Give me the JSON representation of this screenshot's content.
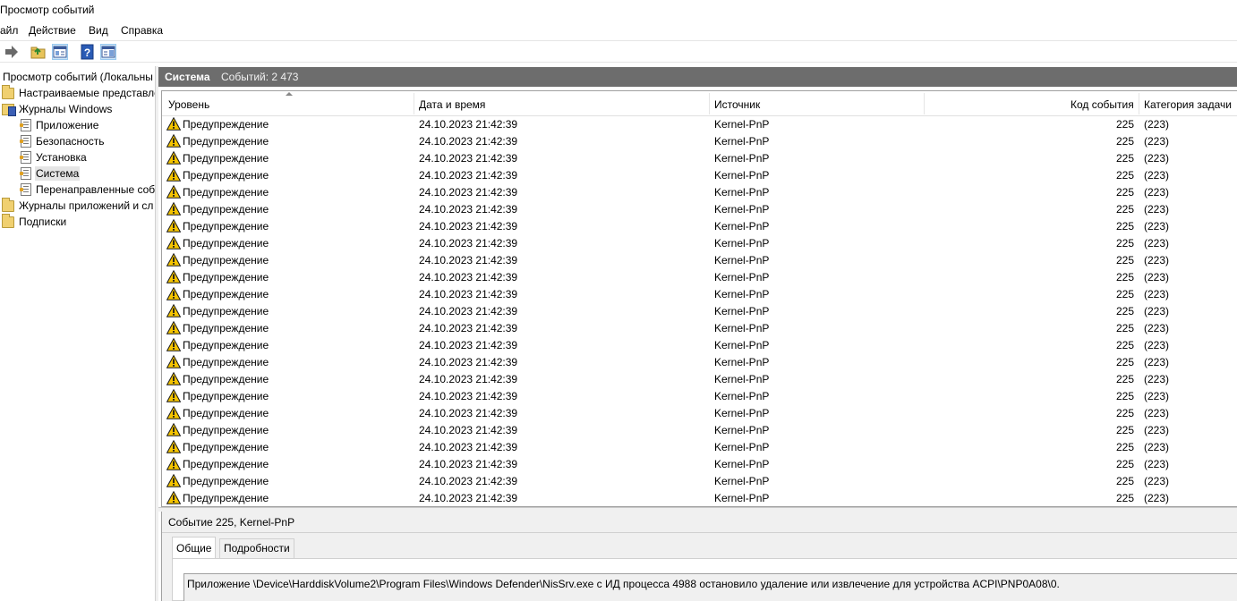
{
  "window": {
    "title": "Просмотр событий"
  },
  "menu": {
    "items": [
      "айл",
      "Действие",
      "Вид",
      "Справка"
    ]
  },
  "toolbar": {
    "buttons": [
      {
        "icon": "forward-arrow-icon",
        "active": false
      },
      {
        "icon": "folder-up-icon",
        "active": false
      },
      {
        "icon": "show-hide-tree-icon",
        "active": true
      },
      {
        "icon": "help-icon",
        "active": false
      },
      {
        "icon": "action-pane-icon",
        "active": true
      }
    ]
  },
  "tree": {
    "root": "Просмотр событий (Локальны",
    "items": [
      {
        "label": "Настраиваемые представле",
        "icon": "folder"
      },
      {
        "label": "Журналы Windows",
        "icon": "logs"
      },
      {
        "label": "Приложение",
        "icon": "log"
      },
      {
        "label": "Безопасность",
        "icon": "log"
      },
      {
        "label": "Установка",
        "icon": "log"
      },
      {
        "label": "Система",
        "icon": "log",
        "selected": true
      },
      {
        "label": "Перенаправленные соб",
        "icon": "log"
      },
      {
        "label": "Журналы приложений и сл",
        "icon": "folder"
      },
      {
        "label": "Подписки",
        "icon": "folder"
      }
    ]
  },
  "log_header": {
    "name": "Система",
    "count_label": "Событий: 2 473"
  },
  "columns": {
    "level": "Уровень",
    "datetime": "Дата и время",
    "source": "Источник",
    "event_id": "Код события",
    "category": "Категория задачи"
  },
  "events": [
    {
      "level": "Предупреждение",
      "datetime": "24.10.2023 21:42:39",
      "source": "Kernel-PnP",
      "event_id": "225",
      "category": "(223)"
    },
    {
      "level": "Предупреждение",
      "datetime": "24.10.2023 21:42:39",
      "source": "Kernel-PnP",
      "event_id": "225",
      "category": "(223)"
    },
    {
      "level": "Предупреждение",
      "datetime": "24.10.2023 21:42:39",
      "source": "Kernel-PnP",
      "event_id": "225",
      "category": "(223)"
    },
    {
      "level": "Предупреждение",
      "datetime": "24.10.2023 21:42:39",
      "source": "Kernel-PnP",
      "event_id": "225",
      "category": "(223)"
    },
    {
      "level": "Предупреждение",
      "datetime": "24.10.2023 21:42:39",
      "source": "Kernel-PnP",
      "event_id": "225",
      "category": "(223)"
    },
    {
      "level": "Предупреждение",
      "datetime": "24.10.2023 21:42:39",
      "source": "Kernel-PnP",
      "event_id": "225",
      "category": "(223)"
    },
    {
      "level": "Предупреждение",
      "datetime": "24.10.2023 21:42:39",
      "source": "Kernel-PnP",
      "event_id": "225",
      "category": "(223)"
    },
    {
      "level": "Предупреждение",
      "datetime": "24.10.2023 21:42:39",
      "source": "Kernel-PnP",
      "event_id": "225",
      "category": "(223)"
    },
    {
      "level": "Предупреждение",
      "datetime": "24.10.2023 21:42:39",
      "source": "Kernel-PnP",
      "event_id": "225",
      "category": "(223)"
    },
    {
      "level": "Предупреждение",
      "datetime": "24.10.2023 21:42:39",
      "source": "Kernel-PnP",
      "event_id": "225",
      "category": "(223)"
    },
    {
      "level": "Предупреждение",
      "datetime": "24.10.2023 21:42:39",
      "source": "Kernel-PnP",
      "event_id": "225",
      "category": "(223)"
    },
    {
      "level": "Предупреждение",
      "datetime": "24.10.2023 21:42:39",
      "source": "Kernel-PnP",
      "event_id": "225",
      "category": "(223)"
    },
    {
      "level": "Предупреждение",
      "datetime": "24.10.2023 21:42:39",
      "source": "Kernel-PnP",
      "event_id": "225",
      "category": "(223)"
    },
    {
      "level": "Предупреждение",
      "datetime": "24.10.2023 21:42:39",
      "source": "Kernel-PnP",
      "event_id": "225",
      "category": "(223)"
    },
    {
      "level": "Предупреждение",
      "datetime": "24.10.2023 21:42:39",
      "source": "Kernel-PnP",
      "event_id": "225",
      "category": "(223)"
    },
    {
      "level": "Предупреждение",
      "datetime": "24.10.2023 21:42:39",
      "source": "Kernel-PnP",
      "event_id": "225",
      "category": "(223)"
    },
    {
      "level": "Предупреждение",
      "datetime": "24.10.2023 21:42:39",
      "source": "Kernel-PnP",
      "event_id": "225",
      "category": "(223)"
    },
    {
      "level": "Предупреждение",
      "datetime": "24.10.2023 21:42:39",
      "source": "Kernel-PnP",
      "event_id": "225",
      "category": "(223)"
    },
    {
      "level": "Предупреждение",
      "datetime": "24.10.2023 21:42:39",
      "source": "Kernel-PnP",
      "event_id": "225",
      "category": "(223)"
    },
    {
      "level": "Предупреждение",
      "datetime": "24.10.2023 21:42:39",
      "source": "Kernel-PnP",
      "event_id": "225",
      "category": "(223)"
    },
    {
      "level": "Предупреждение",
      "datetime": "24.10.2023 21:42:39",
      "source": "Kernel-PnP",
      "event_id": "225",
      "category": "(223)"
    },
    {
      "level": "Предупреждение",
      "datetime": "24.10.2023 21:42:39",
      "source": "Kernel-PnP",
      "event_id": "225",
      "category": "(223)"
    },
    {
      "level": "Предупреждение",
      "datetime": "24.10.2023 21:42:39",
      "source": "Kernel-PnP",
      "event_id": "225",
      "category": "(223)"
    }
  ],
  "details": {
    "title": "Событие 225, Kernel-PnP",
    "tabs": [
      "Общие",
      "Подробности"
    ],
    "active_tab": 0,
    "message": "Приложение \\Device\\HarddiskVolume2\\Program Files\\Windows Defender\\NisSrv.exe с ИД процесса 4988 остановило удаление или извлечение для устройства ACPI\\PNP0A08\\0."
  },
  "colors": {
    "header_bg": "#6d6d6d",
    "selection_bg": "#e5e5e5",
    "warning_yellow": "#f5c400"
  }
}
